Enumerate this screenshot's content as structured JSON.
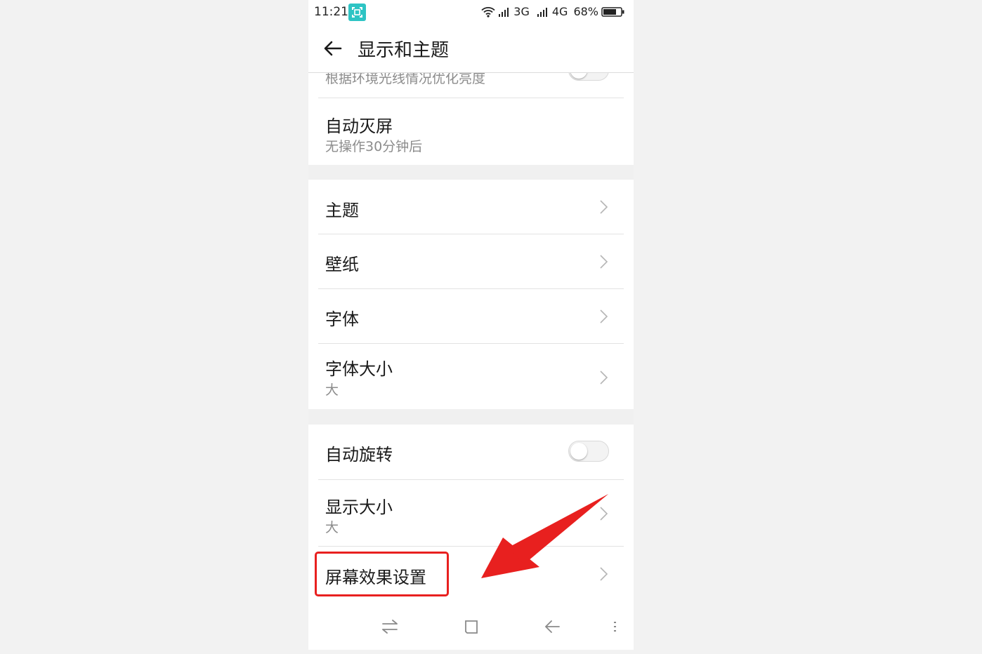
{
  "status_bar": {
    "time": "11:21",
    "network_1": "3G",
    "network_2": "4G",
    "battery": "68%"
  },
  "header": {
    "title": "显示和主题"
  },
  "settings": {
    "brightness_subtitle": "根据环境光线情况优化亮度",
    "auto_screen_off": {
      "title": "自动灭屏",
      "subtitle": "无操作30分钟后"
    },
    "theme": {
      "title": "主题"
    },
    "wallpaper": {
      "title": "壁纸"
    },
    "font": {
      "title": "字体"
    },
    "font_size": {
      "title": "字体大小",
      "subtitle": "大"
    },
    "auto_rotate": {
      "title": "自动旋转",
      "enabled": false
    },
    "display_size": {
      "title": "显示大小",
      "subtitle": "大"
    },
    "screen_effect": {
      "title": "屏幕效果设置"
    }
  },
  "colors": {
    "accent_badge": "#2ec4c4",
    "highlight": "#e8201f"
  },
  "icons": {
    "back": "back-arrow-icon",
    "chevron": "chevron-right-icon",
    "nav_switch": "switch-apps-icon",
    "nav_home": "home-icon",
    "nav_back": "nav-back-icon",
    "nav_menu": "menu-icon"
  }
}
